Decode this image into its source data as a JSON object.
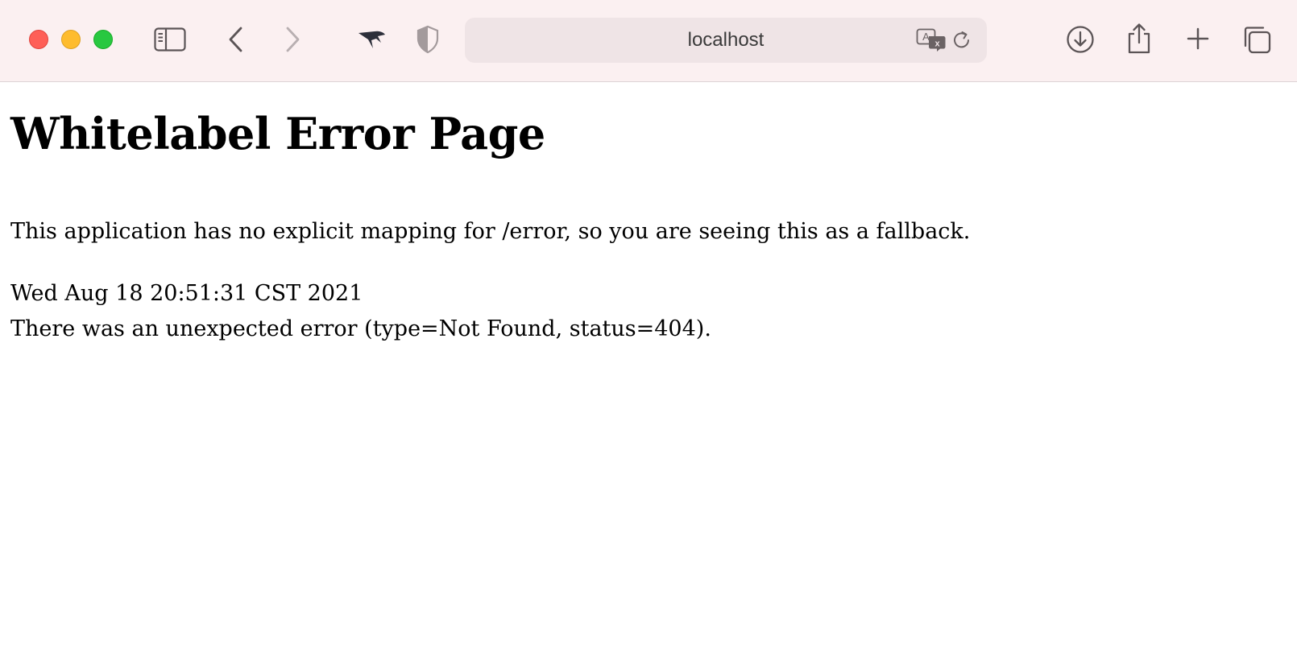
{
  "browser": {
    "address": "localhost"
  },
  "page": {
    "heading": "Whitelabel Error Page",
    "description": "This application has no explicit mapping for /error, so you are seeing this as a fallback.",
    "timestamp": "Wed Aug 18 20:51:31 CST 2021",
    "error_message": "There was an unexpected error (type=Not Found, status=404)."
  },
  "icons": {
    "sidebar": "sidebar-icon",
    "back": "chevron-left-icon",
    "forward": "chevron-right-icon",
    "extension": "bird-icon",
    "privacy": "shield-icon",
    "translate": "translate-icon",
    "reload": "reload-icon",
    "downloads": "download-icon",
    "share": "share-icon",
    "new_tab": "plus-icon",
    "tabs": "tab-overview-icon"
  },
  "colors": {
    "toolbar_bg": "#fbf0f1",
    "address_bg": "#efe4e6",
    "close": "#fe5f57",
    "minimize": "#febc2e",
    "zoom": "#28c840"
  }
}
